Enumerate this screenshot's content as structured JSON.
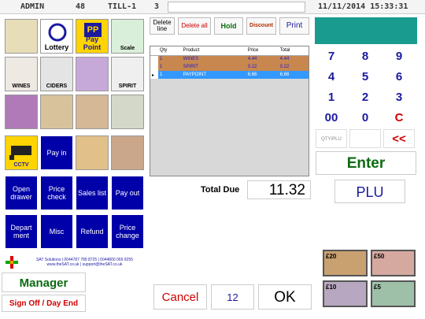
{
  "topbar": {
    "user": "ADMIN",
    "number": "48",
    "till": "TILL-1",
    "count": "3",
    "datetime": "11/11/2014 15:33:31"
  },
  "tiles": [
    {
      "name": "tile-cash",
      "label": ""
    },
    {
      "name": "tile-lottery",
      "label": "Lottery"
    },
    {
      "name": "tile-paypoint",
      "label": "Pay Point"
    },
    {
      "name": "tile-scale",
      "label": "Scale"
    },
    {
      "name": "tile-wines",
      "label": "WINES"
    },
    {
      "name": "tile-ciders",
      "label": "CIDERS"
    },
    {
      "name": "tile-tools",
      "label": ""
    },
    {
      "name": "tile-spirit",
      "label": "SPIRIT"
    },
    {
      "name": "tile-fruit",
      "label": ""
    },
    {
      "name": "tile-grocery",
      "label": ""
    },
    {
      "name": "tile-shop",
      "label": ""
    },
    {
      "name": "tile-food",
      "label": ""
    },
    {
      "name": "tile-cctv",
      "label": "CCTV"
    },
    {
      "name": "tile-pay-in",
      "label": "Pay in"
    },
    {
      "name": "tile-bread",
      "label": ""
    },
    {
      "name": "tile-sweets",
      "label": ""
    }
  ],
  "blue_buttons": [
    {
      "name": "open-drawer-button",
      "label": "Open drawer"
    },
    {
      "name": "price-check-button",
      "label": "Price check"
    },
    {
      "name": "sales-list-button",
      "label": "Sales list"
    },
    {
      "name": "pay-out-button",
      "label": "Pay out"
    },
    {
      "name": "department-button",
      "label": "Depart ment"
    },
    {
      "name": "misc-button",
      "label": "Misc"
    },
    {
      "name": "refund-button",
      "label": "Refund"
    },
    {
      "name": "price-change-button",
      "label": "Price change"
    }
  ],
  "actions": {
    "delete_line": "Delete line",
    "delete_all": "Delete all",
    "hold": "Hold",
    "discount": "Discount",
    "print": "Print"
  },
  "basket": {
    "headers": [
      "Qty",
      "Product",
      "Price",
      "Total"
    ],
    "rows": [
      {
        "qty": "1",
        "product": "WINES",
        "price": "4.44",
        "total": "4.44"
      },
      {
        "qty": "1",
        "product": "SPIRIT",
        "price": "0.22",
        "total": "0.22"
      },
      {
        "qty": "1",
        "product": "PAYPOINT",
        "price": "6.66",
        "total": "6.66"
      }
    ]
  },
  "total_due_label": "Total Due",
  "total_due_value": "11.32",
  "keypad": [
    "7",
    "8",
    "9",
    "4",
    "5",
    "6",
    "1",
    "2",
    "3",
    "00",
    "0",
    "C",
    "QTY/PLU",
    "",
    "<<"
  ],
  "enter_label": "Enter",
  "plu_label": "PLU",
  "company": {
    "line1": "SAT Solutions | 0044787 789 8725 | 0044800 069 9255",
    "line2": "www.theSAT.co.uk | support@theSAT.co.uk"
  },
  "manager_label": "Manager",
  "signoff_label": "Sign Off / Day End",
  "cancel_label": "Cancel",
  "qty_value": "12",
  "ok_label": "OK",
  "notes": [
    "£20",
    "£50",
    "£10",
    "£5"
  ],
  "colors": {
    "teal": "#1a9b8f",
    "blue_button": "#0000a8",
    "accent_red": "#d00000",
    "enter_green": "#0b6b10"
  }
}
